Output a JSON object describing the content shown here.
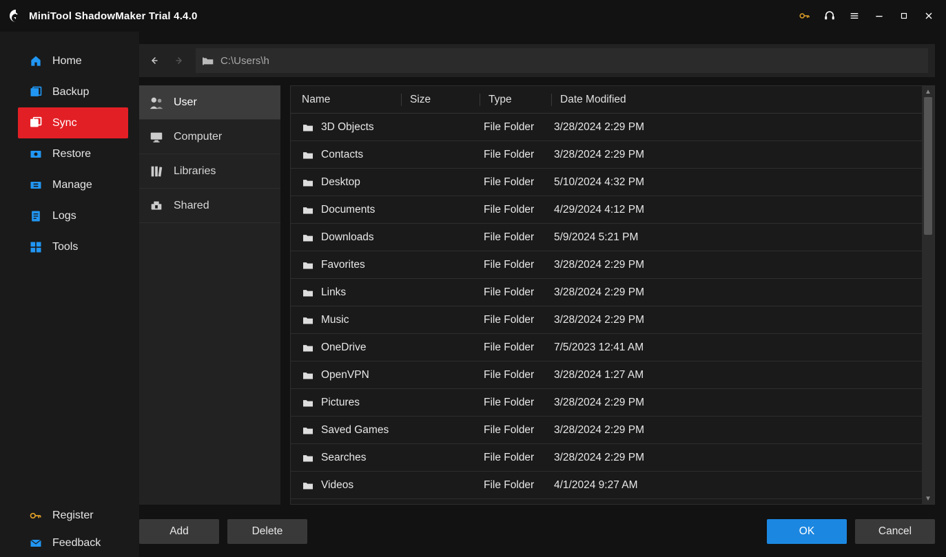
{
  "app": {
    "title": "MiniTool ShadowMaker Trial 4.4.0"
  },
  "sidebar": {
    "items": [
      {
        "label": "Home",
        "icon": "home"
      },
      {
        "label": "Backup",
        "icon": "backup"
      },
      {
        "label": "Sync",
        "icon": "sync"
      },
      {
        "label": "Restore",
        "icon": "restore"
      },
      {
        "label": "Manage",
        "icon": "manage"
      },
      {
        "label": "Logs",
        "icon": "logs"
      },
      {
        "label": "Tools",
        "icon": "tools"
      }
    ],
    "active_index": 2,
    "bottom": [
      {
        "label": "Register",
        "icon": "key"
      },
      {
        "label": "Feedback",
        "icon": "mail"
      }
    ]
  },
  "path": {
    "value": "C:\\Users\\h"
  },
  "locations": {
    "items": [
      {
        "label": "User",
        "icon": "user"
      },
      {
        "label": "Computer",
        "icon": "computer"
      },
      {
        "label": "Libraries",
        "icon": "libraries"
      },
      {
        "label": "Shared",
        "icon": "shared"
      }
    ],
    "active_index": 0
  },
  "table": {
    "headers": {
      "name": "Name",
      "size": "Size",
      "type": "Type",
      "date": "Date Modified"
    },
    "rows": [
      {
        "name": "3D Objects",
        "type": "File Folder",
        "date": "3/28/2024 2:29 PM"
      },
      {
        "name": "Contacts",
        "type": "File Folder",
        "date": "3/28/2024 2:29 PM"
      },
      {
        "name": "Desktop",
        "type": "File Folder",
        "date": "5/10/2024 4:32 PM"
      },
      {
        "name": "Documents",
        "type": "File Folder",
        "date": "4/29/2024 4:12 PM"
      },
      {
        "name": "Downloads",
        "type": "File Folder",
        "date": "5/9/2024 5:21 PM"
      },
      {
        "name": "Favorites",
        "type": "File Folder",
        "date": "3/28/2024 2:29 PM"
      },
      {
        "name": "Links",
        "type": "File Folder",
        "date": "3/28/2024 2:29 PM"
      },
      {
        "name": "Music",
        "type": "File Folder",
        "date": "3/28/2024 2:29 PM"
      },
      {
        "name": "OneDrive",
        "type": "File Folder",
        "date": "7/5/2023 12:41 AM"
      },
      {
        "name": "OpenVPN",
        "type": "File Folder",
        "date": "3/28/2024 1:27 AM"
      },
      {
        "name": "Pictures",
        "type": "File Folder",
        "date": "3/28/2024 2:29 PM"
      },
      {
        "name": "Saved Games",
        "type": "File Folder",
        "date": "3/28/2024 2:29 PM"
      },
      {
        "name": "Searches",
        "type": "File Folder",
        "date": "3/28/2024 2:29 PM"
      },
      {
        "name": "Videos",
        "type": "File Folder",
        "date": "4/1/2024 9:27 AM"
      }
    ]
  },
  "buttons": {
    "add": "Add",
    "delete": "Delete",
    "ok": "OK",
    "cancel": "Cancel"
  }
}
